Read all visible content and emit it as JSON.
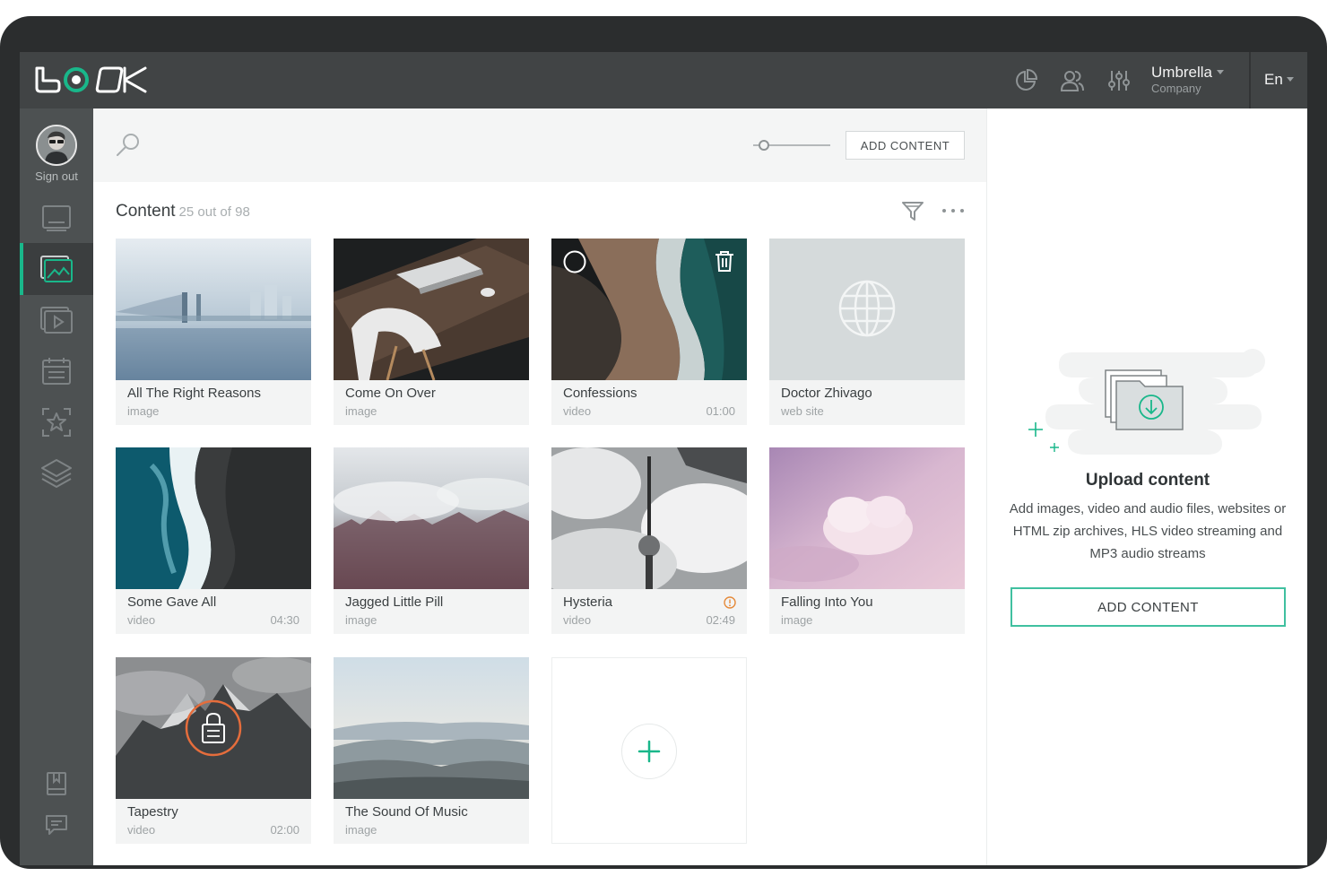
{
  "app": {
    "logo_text": "LOOK"
  },
  "header": {
    "org_name": "Umbrella",
    "org_role": "Company",
    "language": "En",
    "icons": [
      "analytics-icon",
      "users-icon",
      "settings-sliders-icon"
    ]
  },
  "sidebar": {
    "sign_out": "Sign out",
    "items": [
      "screens-icon",
      "content-icon",
      "playlists-icon",
      "schedule-icon",
      "widgets-icon",
      "layers-icon"
    ],
    "bottom_items": [
      "guide-icon",
      "chat-icon"
    ],
    "active_index": 1
  },
  "toolbar": {
    "add_content": "ADD CONTENT"
  },
  "content": {
    "title": "Content",
    "count": "25 out of 98",
    "items": [
      {
        "name": "All The Right Reasons",
        "type": "image",
        "duration": ""
      },
      {
        "name": "Come On Over",
        "type": "image",
        "duration": ""
      },
      {
        "name": "Confessions",
        "type": "video",
        "duration": "01:00"
      },
      {
        "name": "Doctor Zhivago",
        "type": "web site",
        "duration": ""
      },
      {
        "name": "Some Gave All",
        "type": "video",
        "duration": "04:30"
      },
      {
        "name": "Jagged Little Pill",
        "type": "image",
        "duration": ""
      },
      {
        "name": "Hysteria",
        "type": "video",
        "duration": "02:49"
      },
      {
        "name": "Falling Into You",
        "type": "image",
        "duration": ""
      },
      {
        "name": "Tapestry",
        "type": "video",
        "duration": "02:00"
      },
      {
        "name": "The Sound Of Music",
        "type": "image",
        "duration": ""
      }
    ]
  },
  "upload": {
    "title": "Upload content",
    "description": "Add images, video and audio files, websites or HTML zip archives, HLS video streaming and MP3 audio streams",
    "button": "ADD CONTENT"
  },
  "colors": {
    "accent": "#19b78a",
    "topbar": "#414445",
    "sidebar": "#4d5152",
    "warning": "#e58a3a"
  }
}
